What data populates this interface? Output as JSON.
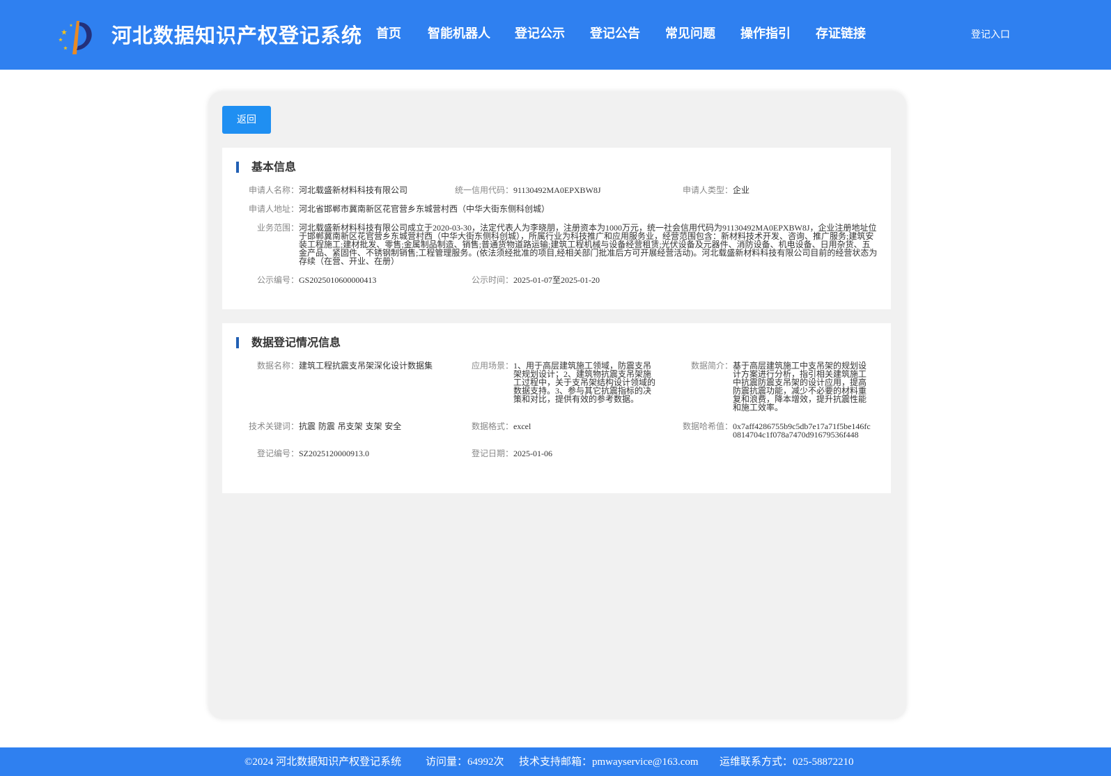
{
  "header": {
    "title": "河北数据知识产权登记系统",
    "nav": [
      "首页",
      "智能机器人",
      "登记公示",
      "登记公告",
      "常见问题",
      "操作指引",
      "存证链接"
    ],
    "login": "登记入口",
    "logo_icon": "torch-logo-icon",
    "brand_color": "#2f80f0"
  },
  "back_button": "返回",
  "basic_info": {
    "title": "基本信息",
    "applicant_name_label": "申请人名称：",
    "applicant_name": "河北载盛新材料科技有限公司",
    "credit_code_label": "统一信用代码：",
    "credit_code": "91130492MA0EPXBW8J",
    "applicant_type_label": "申请人类型：",
    "applicant_type": "企业",
    "address_label": "申请人地址：",
    "address": "河北省邯郸市冀南新区花官营乡东城营村西（中华大街东侧科创城）",
    "scope_label": "业务范围：",
    "scope": "河北载盛新材料科技有限公司成立于2020-03-30，法定代表人为李晓朋，注册资本为1000万元，统一社会信用代码为91130492MA0EPXBW8J，企业注册地址位于邯郸冀南新区花官营乡东城营村西（中华大街东侧科创城），所属行业为科技推广和应用服务业，经营范围包含：新材料技术开发、咨询、推广服务;建筑安装工程施工;建材批发、零售;金属制品制造、销售;普通货物道路运输;建筑工程机械与设备经营租赁;光伏设备及元器件、消防设备、机电设备、日用杂货、五金产品、紧固件、不锈钢制销售;工程管理服务。(依法须经批准的项目,经相关部门批准后方可开展经营活动)。河北载盛新材料科技有限公司目前的经营状态为存续（在营、开业、在册）",
    "pub_no_label": "公示编号：",
    "pub_no": "GS2025010600000413",
    "pub_time_label": "公示时间：",
    "pub_time": "2025-01-07至2025-01-20"
  },
  "reg_info": {
    "title": "数据登记情况信息",
    "data_name_label": "数据名称：",
    "data_name": "建筑工程抗震支吊架深化设计数据集",
    "scenario_label": "应用场景：",
    "scenario": "1、用于高层建筑施工领域，防震支吊架规划设计；2、建筑物抗震支吊架施工过程中，关于支吊架结构设计领域的数据支持。3、参与其它抗震指标的决策和对比，提供有效的参考数据。",
    "intro_label": "数据简介：",
    "intro": "基于高层建筑施工中支吊架的规划设计方案进行分析，指引相关建筑施工中抗震防震支吊架的设计应用，提高防震抗震功能，减少不必要的材料重复和浪费，降本增效，提升抗震性能和施工效率。",
    "keywords_label": "技术关键词：",
    "keywords": "抗震 防震 吊支架 支架 安全",
    "format_label": "数据格式：",
    "format": "excel",
    "hash_label": "数据哈希值：",
    "hash": "0x7aff4286755b9c5db7e17a71f5be146fc0814704c1f078a7470d91679536f448",
    "reg_no_label": "登记编号：",
    "reg_no": "SZ2025120000913.0",
    "reg_date_label": "登记日期：",
    "reg_date": "2025-01-06"
  },
  "footer": {
    "copyright": "©2024 河北数据知识产权登记系统",
    "visits": "访问量：64992次",
    "email": "技术支持邮箱：pmwayservice@163.com",
    "phone": "运维联系方式：025-58872210"
  }
}
